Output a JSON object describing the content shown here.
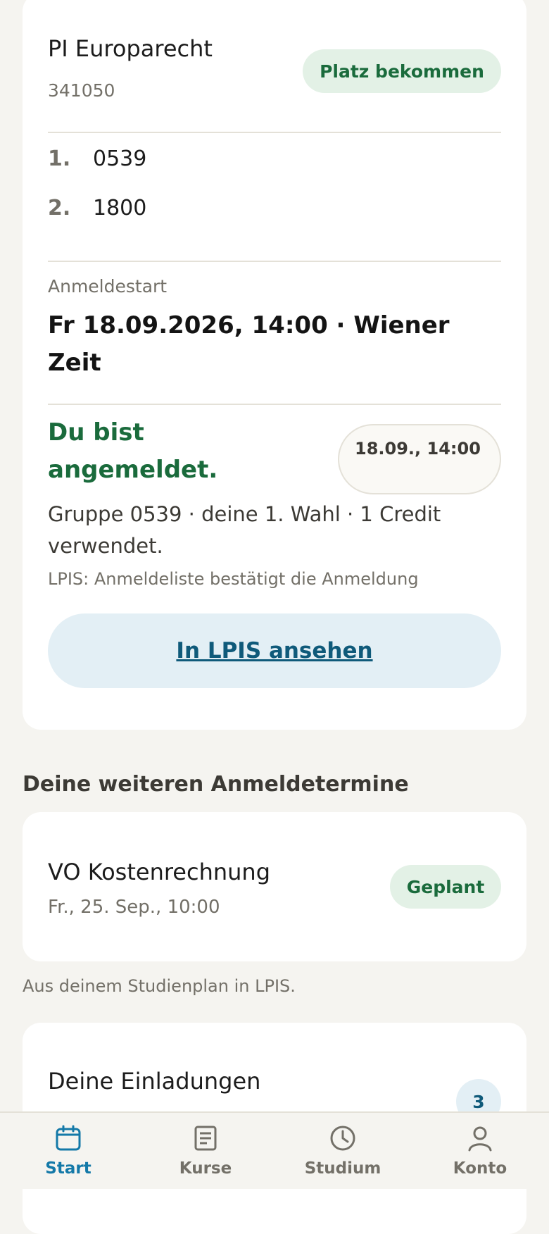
{
  "course": {
    "title": "PI Europarecht",
    "code": "341050",
    "status": "Platz bekommen",
    "groups": [
      {
        "rank": "1.",
        "value": "0539"
      },
      {
        "rank": "2.",
        "value": "1800"
      }
    ],
    "start_label": "Anmeldestart",
    "start_value": "Fr 18.09.2026, 14:00 · Wiener Zeit",
    "registered_text": "Du bist angemeldet.",
    "registered_date": "18.09., 14:00",
    "registered_detail": "Gruppe 0539 · deine 1. Wahl · 1 Credit verwendet.",
    "lpis_note": "LPIS: Anmeldeliste bestätigt die Anmeldung",
    "lpis_button": "In LPIS ansehen"
  },
  "more_appointments": {
    "heading": "Deine weiteren Anmeldetermine",
    "items": [
      {
        "title": "VO Kostenrechnung",
        "date": "Fr., 25. Sep., 10:00",
        "status": "Geplant"
      }
    ],
    "note": "Aus deinem Studienplan in LPIS."
  },
  "invites": {
    "title": "Deine Einladungen",
    "count": "3"
  },
  "nav": {
    "active": "start",
    "items": [
      {
        "id": "start",
        "label": "Start",
        "icon": "calendar-icon"
      },
      {
        "id": "kurse",
        "label": "Kurse",
        "icon": "document-icon"
      },
      {
        "id": "studium",
        "label": "Studium",
        "icon": "clock-icon"
      },
      {
        "id": "konto",
        "label": "Konto",
        "icon": "user-icon"
      }
    ]
  },
  "colors": {
    "accent": "#1479a8",
    "success": "#1a6b3c",
    "background": "#f5f4f0"
  }
}
